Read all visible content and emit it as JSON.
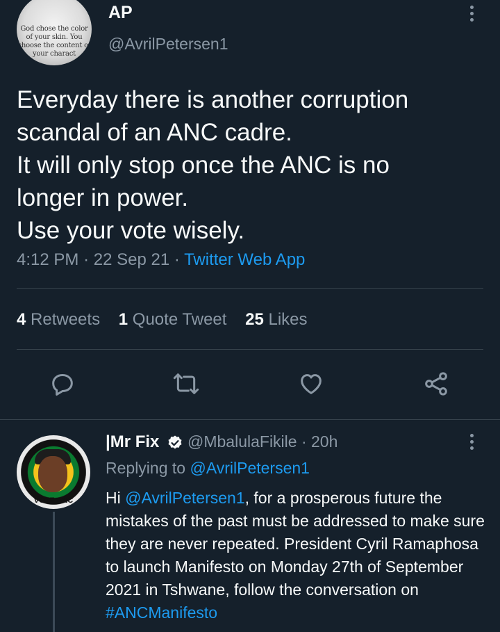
{
  "tweet": {
    "author_name": "AP",
    "author_handle": "@AvrilPetersen1",
    "avatar_text": "God chose the color of your skin. You choose the content of your charact",
    "text": "Everyday there is another corruption\nscandal of an ANC cadre.\nIt will only stop once the ANC is no\nlonger in power.\nUse your vote wisely.",
    "time": "4:12 PM",
    "date": "22 Sep 21",
    "separator": "·",
    "source": "Twitter Web App",
    "stats": {
      "retweets_count": "4",
      "retweets_label": "Retweets",
      "quotes_count": "1",
      "quotes_label": "Quote Tweet",
      "likes_count": "25",
      "likes_label": "Likes"
    },
    "actions": [
      "reply-icon",
      "retweet-icon",
      "like-icon",
      "share-icon"
    ]
  },
  "reply": {
    "author_name": "|Mr Fix",
    "author_handle": "@MbalulaFikile",
    "time": "· 20h",
    "avatar_text": "VOTE ANC",
    "replying_prefix": "Replying to",
    "replying_handle": "@AvrilPetersen1",
    "text_parts": {
      "greeting": "Hi ",
      "mention": "@AvrilPetersen1",
      "body": ", for a prosperous future the mistakes of the past must be addressed to make sure they are never repeated. President Cyril Ramaphosa to launch  Manifesto on Monday 27th of September 2021 in Tshwane, follow the conversation on ",
      "hashtag": "#ANCManifesto"
    }
  },
  "colors": {
    "background": "#15202b",
    "text": "#f7f9f9",
    "muted": "#8b98a5",
    "link": "#1d9bf0",
    "divider": "#38444d"
  }
}
